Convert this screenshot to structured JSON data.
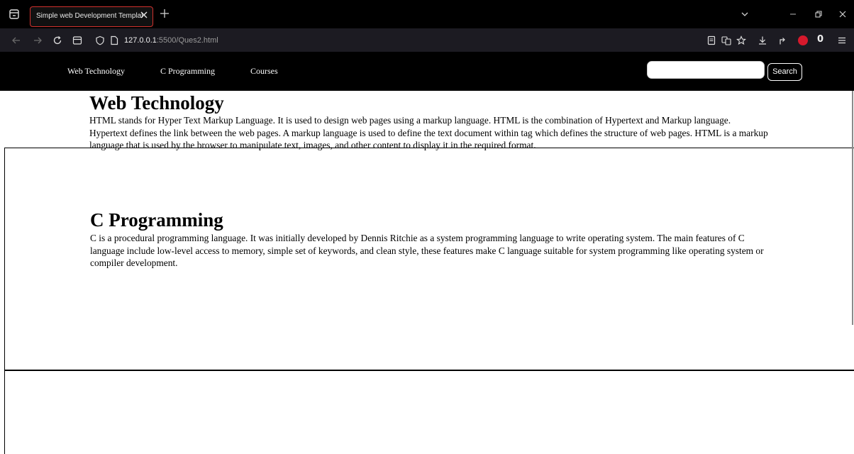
{
  "browser": {
    "tab": {
      "title": "Simple web Development Template"
    },
    "url": {
      "host": "127.0.0.1",
      "rest": ":5500/Ques2.html"
    },
    "badge_count": "0",
    "colors": {
      "tab_border": "#d0312d",
      "extension_red": "#d6192c"
    },
    "icons": [
      "tab-list-icon",
      "close-icon",
      "plus-icon",
      "chevron-down-icon",
      "minimize-icon",
      "restore-icon",
      "back-icon",
      "forward-icon",
      "reload-icon",
      "sidebar-icon",
      "shield-icon",
      "page-icon",
      "reader-icon",
      "translate-icon",
      "star-icon",
      "download-icon",
      "share-icon",
      "extension-icon",
      "menu-icon"
    ]
  },
  "nav": {
    "links": [
      "Web Technology",
      "C Programming",
      "Courses"
    ],
    "search_label": "Search"
  },
  "sections": [
    {
      "title": "Web Technology",
      "body": "HTML stands for Hyper Text Markup Language. It is used to design web pages using a markup language. HTML is the combination of Hypertext and Markup language. Hypertext defines the link between the web pages. A markup language is used to define the text document within tag which defines the structure of web pages. HTML is a markup language that is used by the browser to manipulate text, images, and other content to display it in the required format."
    },
    {
      "title": "C Programming",
      "body": "C is a procedural programming language. It was initially developed by Dennis Ritchie as a system programming language to write operating system. The main features of C language include low-level access to memory, simple set of keywords, and clean style, these features make C language suitable for system programming like operating system or compiler development."
    }
  ]
}
